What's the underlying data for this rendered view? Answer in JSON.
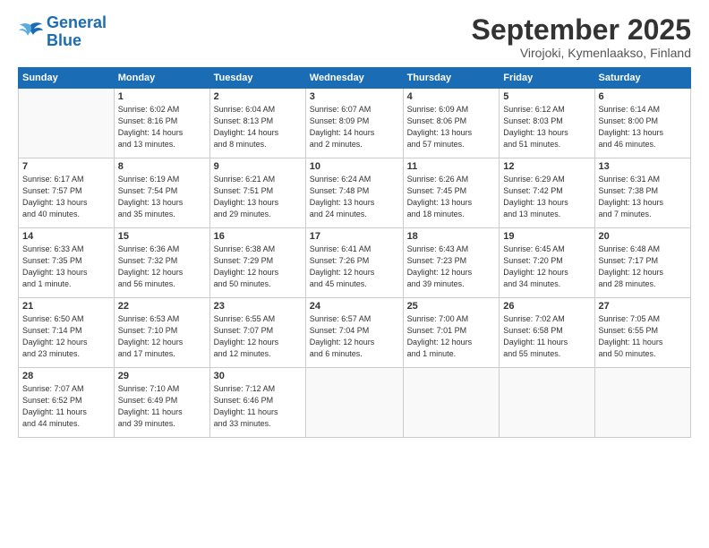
{
  "header": {
    "logo_general": "General",
    "logo_blue": "Blue",
    "month_title": "September 2025",
    "subtitle": "Virojoki, Kymenlaakso, Finland"
  },
  "days_of_week": [
    "Sunday",
    "Monday",
    "Tuesday",
    "Wednesday",
    "Thursday",
    "Friday",
    "Saturday"
  ],
  "weeks": [
    [
      {
        "day": "",
        "info": ""
      },
      {
        "day": "1",
        "info": "Sunrise: 6:02 AM\nSunset: 8:16 PM\nDaylight: 14 hours\nand 13 minutes."
      },
      {
        "day": "2",
        "info": "Sunrise: 6:04 AM\nSunset: 8:13 PM\nDaylight: 14 hours\nand 8 minutes."
      },
      {
        "day": "3",
        "info": "Sunrise: 6:07 AM\nSunset: 8:09 PM\nDaylight: 14 hours\nand 2 minutes."
      },
      {
        "day": "4",
        "info": "Sunrise: 6:09 AM\nSunset: 8:06 PM\nDaylight: 13 hours\nand 57 minutes."
      },
      {
        "day": "5",
        "info": "Sunrise: 6:12 AM\nSunset: 8:03 PM\nDaylight: 13 hours\nand 51 minutes."
      },
      {
        "day": "6",
        "info": "Sunrise: 6:14 AM\nSunset: 8:00 PM\nDaylight: 13 hours\nand 46 minutes."
      }
    ],
    [
      {
        "day": "7",
        "info": "Sunrise: 6:17 AM\nSunset: 7:57 PM\nDaylight: 13 hours\nand 40 minutes."
      },
      {
        "day": "8",
        "info": "Sunrise: 6:19 AM\nSunset: 7:54 PM\nDaylight: 13 hours\nand 35 minutes."
      },
      {
        "day": "9",
        "info": "Sunrise: 6:21 AM\nSunset: 7:51 PM\nDaylight: 13 hours\nand 29 minutes."
      },
      {
        "day": "10",
        "info": "Sunrise: 6:24 AM\nSunset: 7:48 PM\nDaylight: 13 hours\nand 24 minutes."
      },
      {
        "day": "11",
        "info": "Sunrise: 6:26 AM\nSunset: 7:45 PM\nDaylight: 13 hours\nand 18 minutes."
      },
      {
        "day": "12",
        "info": "Sunrise: 6:29 AM\nSunset: 7:42 PM\nDaylight: 13 hours\nand 13 minutes."
      },
      {
        "day": "13",
        "info": "Sunrise: 6:31 AM\nSunset: 7:38 PM\nDaylight: 13 hours\nand 7 minutes."
      }
    ],
    [
      {
        "day": "14",
        "info": "Sunrise: 6:33 AM\nSunset: 7:35 PM\nDaylight: 13 hours\nand 1 minute."
      },
      {
        "day": "15",
        "info": "Sunrise: 6:36 AM\nSunset: 7:32 PM\nDaylight: 12 hours\nand 56 minutes."
      },
      {
        "day": "16",
        "info": "Sunrise: 6:38 AM\nSunset: 7:29 PM\nDaylight: 12 hours\nand 50 minutes."
      },
      {
        "day": "17",
        "info": "Sunrise: 6:41 AM\nSunset: 7:26 PM\nDaylight: 12 hours\nand 45 minutes."
      },
      {
        "day": "18",
        "info": "Sunrise: 6:43 AM\nSunset: 7:23 PM\nDaylight: 12 hours\nand 39 minutes."
      },
      {
        "day": "19",
        "info": "Sunrise: 6:45 AM\nSunset: 7:20 PM\nDaylight: 12 hours\nand 34 minutes."
      },
      {
        "day": "20",
        "info": "Sunrise: 6:48 AM\nSunset: 7:17 PM\nDaylight: 12 hours\nand 28 minutes."
      }
    ],
    [
      {
        "day": "21",
        "info": "Sunrise: 6:50 AM\nSunset: 7:14 PM\nDaylight: 12 hours\nand 23 minutes."
      },
      {
        "day": "22",
        "info": "Sunrise: 6:53 AM\nSunset: 7:10 PM\nDaylight: 12 hours\nand 17 minutes."
      },
      {
        "day": "23",
        "info": "Sunrise: 6:55 AM\nSunset: 7:07 PM\nDaylight: 12 hours\nand 12 minutes."
      },
      {
        "day": "24",
        "info": "Sunrise: 6:57 AM\nSunset: 7:04 PM\nDaylight: 12 hours\nand 6 minutes."
      },
      {
        "day": "25",
        "info": "Sunrise: 7:00 AM\nSunset: 7:01 PM\nDaylight: 12 hours\nand 1 minute."
      },
      {
        "day": "26",
        "info": "Sunrise: 7:02 AM\nSunset: 6:58 PM\nDaylight: 11 hours\nand 55 minutes."
      },
      {
        "day": "27",
        "info": "Sunrise: 7:05 AM\nSunset: 6:55 PM\nDaylight: 11 hours\nand 50 minutes."
      }
    ],
    [
      {
        "day": "28",
        "info": "Sunrise: 7:07 AM\nSunset: 6:52 PM\nDaylight: 11 hours\nand 44 minutes."
      },
      {
        "day": "29",
        "info": "Sunrise: 7:10 AM\nSunset: 6:49 PM\nDaylight: 11 hours\nand 39 minutes."
      },
      {
        "day": "30",
        "info": "Sunrise: 7:12 AM\nSunset: 6:46 PM\nDaylight: 11 hours\nand 33 minutes."
      },
      {
        "day": "",
        "info": ""
      },
      {
        "day": "",
        "info": ""
      },
      {
        "day": "",
        "info": ""
      },
      {
        "day": "",
        "info": ""
      }
    ]
  ]
}
